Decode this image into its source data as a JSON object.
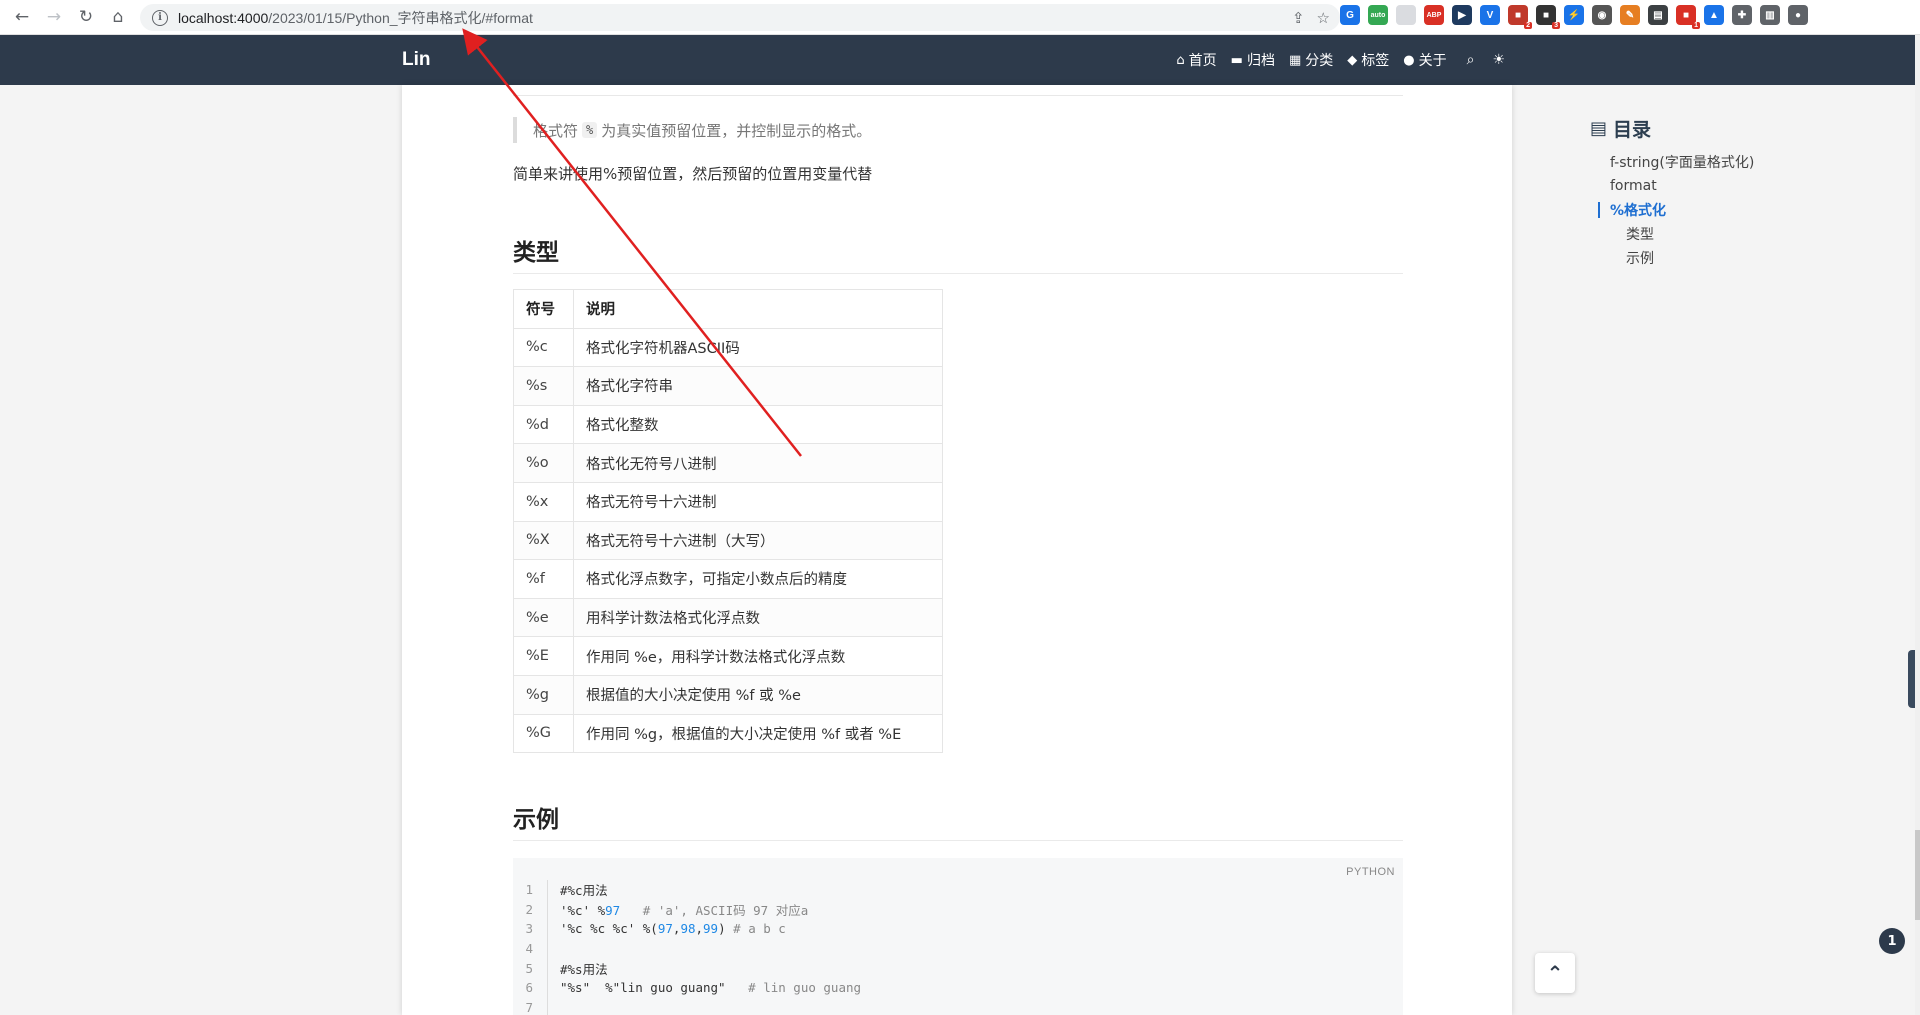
{
  "browser": {
    "url_host": "localhost:4000",
    "url_path": "/2023/01/15/Python_字符串格式化/#format",
    "extensions": [
      {
        "name": "sync-extension-icon",
        "color": "#1a73e8",
        "glyph": "G"
      },
      {
        "name": "auto-extension-icon",
        "color": "#34a853",
        "glyph": "auto"
      },
      {
        "name": "doc-extension-icon",
        "color": "#dadce0",
        "glyph": ""
      },
      {
        "name": "adblock-extension-icon",
        "color": "#d93025",
        "glyph": "ABP"
      },
      {
        "name": "media-extension-icon",
        "color": "#1e3a5f",
        "glyph": "▶"
      },
      {
        "name": "vue-extension-icon",
        "color": "#1a73e8",
        "glyph": "V"
      },
      {
        "name": "red-extension-icon",
        "color": "#c0392b",
        "glyph": "■",
        "badge": "2"
      },
      {
        "name": "dark-extension-icon",
        "color": "#333333",
        "glyph": "■",
        "badge": "3"
      },
      {
        "name": "bolt-extension-icon",
        "color": "#1a73e8",
        "glyph": "⚡"
      },
      {
        "name": "globe-extension-icon",
        "color": "#555555",
        "glyph": "◉"
      },
      {
        "name": "note-extension-icon",
        "color": "#e67e22",
        "glyph": "✎"
      },
      {
        "name": "window-extension-icon",
        "color": "#3c4043",
        "glyph": "▤"
      },
      {
        "name": "translate-extension-icon",
        "color": "#d93025",
        "glyph": "■",
        "badge": "1"
      },
      {
        "name": "triangle-extension-icon",
        "color": "#1a73e8",
        "glyph": "▲"
      },
      {
        "name": "puzzle-extension-icon",
        "color": "#5f6368",
        "glyph": "✚"
      },
      {
        "name": "sidepanel-extension-icon",
        "color": "#5f6368",
        "glyph": "▥"
      },
      {
        "name": "profile-extension-icon",
        "color": "#5f6368",
        "glyph": "●"
      }
    ]
  },
  "site": {
    "brand": "Lin",
    "menu": [
      {
        "label": "首页",
        "icon": "home-icon"
      },
      {
        "label": "归档",
        "icon": "archive-icon"
      },
      {
        "label": "分类",
        "icon": "category-icon"
      },
      {
        "label": "标签",
        "icon": "tags-icon"
      },
      {
        "label": "关于",
        "icon": "user-icon"
      }
    ]
  },
  "content": {
    "quote_before": "格式符",
    "quote_code": "%",
    "quote_after": "为真实值预留位置，并控制显示的格式。",
    "para": "简单来讲使用%预留位置，然后预留的位置用变量代替",
    "h_types": "类型",
    "table_headers": [
      "符号",
      "说明"
    ],
    "table_rows": [
      [
        "%c",
        "格式化字符机器ASCII码"
      ],
      [
        "%s",
        "格式化字符串"
      ],
      [
        "%d",
        "格式化整数"
      ],
      [
        "%o",
        "格式化无符号八进制"
      ],
      [
        "%x",
        "格式无符号十六进制"
      ],
      [
        "%X",
        "格式无符号十六进制（大写）"
      ],
      [
        "%f",
        "格式化浮点数字，可指定小数点后的精度"
      ],
      [
        "%e",
        "用科学计数法格式化浮点数"
      ],
      [
        "%E",
        "作用同 %e，用科学计数法格式化浮点数"
      ],
      [
        "%g",
        "根据值的大小决定使用 %f 或 %e"
      ],
      [
        "%G",
        "作用同 %g，根据值的大小决定使用 %f 或者 %E"
      ]
    ],
    "h_example": "示例",
    "code_lang": "PYTHON",
    "code": [
      {
        "n": "1",
        "parts": [
          {
            "t": "#%c用法",
            "c": "str"
          }
        ]
      },
      {
        "n": "2",
        "parts": [
          {
            "t": "'%c' %",
            "c": "str"
          },
          {
            "t": "97",
            "c": "num"
          },
          {
            "t": "   # 'a', ASCII码 97 对应a",
            "c": "cm"
          }
        ]
      },
      {
        "n": "3",
        "parts": [
          {
            "t": "'%c %c %c' %(",
            "c": "str"
          },
          {
            "t": "97",
            "c": "num"
          },
          {
            "t": ",",
            "c": "str"
          },
          {
            "t": "98",
            "c": "num"
          },
          {
            "t": ",",
            "c": "str"
          },
          {
            "t": "99",
            "c": "num"
          },
          {
            "t": ") ",
            "c": "str"
          },
          {
            "t": "# a b c",
            "c": "cm"
          }
        ]
      },
      {
        "n": "4",
        "parts": [
          {
            "t": "",
            "c": "str"
          }
        ]
      },
      {
        "n": "5",
        "parts": [
          {
            "t": "#%s用法",
            "c": "str"
          }
        ]
      },
      {
        "n": "6",
        "parts": [
          {
            "t": "\"%s\"  %\"lin guo guang\"",
            "c": "str"
          },
          {
            "t": "   # lin guo guang",
            "c": "cm"
          }
        ]
      },
      {
        "n": "7",
        "parts": [
          {
            "t": "",
            "c": "str"
          }
        ]
      }
    ]
  },
  "toc": {
    "title": "目录",
    "items": [
      {
        "label": "f-string(字面量格式化)",
        "level": 1,
        "active": false
      },
      {
        "label": "format",
        "level": 1,
        "active": false
      },
      {
        "label": "%格式化",
        "level": 1,
        "active": true
      },
      {
        "label": "类型",
        "level": 2,
        "active": false
      },
      {
        "label": "示例",
        "level": 2,
        "active": false
      }
    ]
  },
  "float": {
    "back_top": "⌃",
    "notification_count": "1"
  }
}
